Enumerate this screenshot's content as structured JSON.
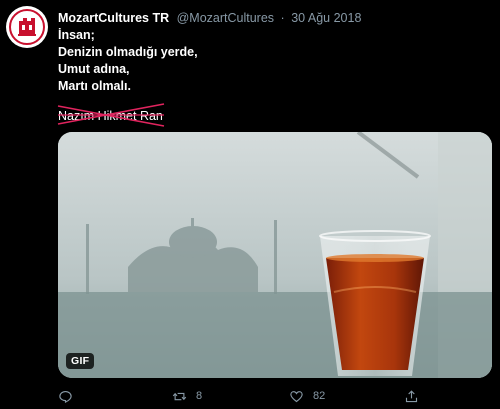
{
  "tweet": {
    "display_name": "MozartCultures TR",
    "handle": "@MozartCultures",
    "separator": "·",
    "date": "30 Ağu 2018",
    "lines": [
      "İnsan;",
      "Denizin olmadığı yerde,",
      "Umut adına,",
      "Martı olmalı."
    ],
    "signature": "Nazım Hikmet Ran",
    "media_badge": "GIF"
  },
  "actions": {
    "reply_icon": "reply-icon",
    "retweet_icon": "retweet-icon",
    "retweet_count": "8",
    "like_icon": "heart-icon",
    "like_count": "82",
    "share_icon": "share-icon"
  },
  "colors": {
    "background": "#000000",
    "secondary_text": "#8899a6",
    "strike": "#e0245e",
    "avatar_brand": "#c8102e"
  }
}
